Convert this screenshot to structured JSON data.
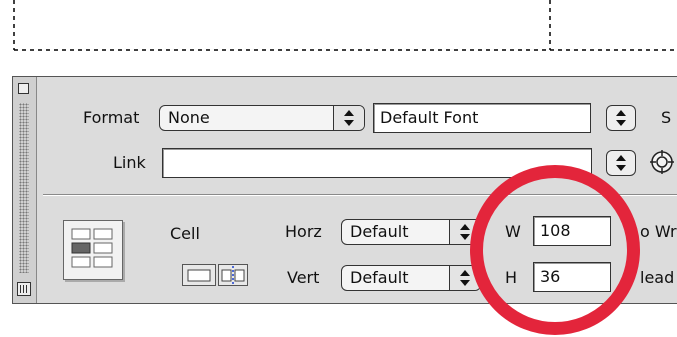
{
  "toolbar_top": {
    "format_label": "Format",
    "format_value": "None",
    "font_value": "Default Font",
    "size_label_partial": "S",
    "link_label": "Link",
    "link_value": ""
  },
  "cell_section": {
    "cell_label": "Cell",
    "horz_label": "Horz",
    "horz_value": "Default",
    "vert_label": "Vert",
    "vert_value": "Default",
    "w_label": "W",
    "w_value": "108",
    "h_label": "H",
    "h_value": "36",
    "nowrap_partial": "o Wr",
    "header_partial": "lead"
  },
  "colors": {
    "annotation_circle": "#e3253b",
    "panel_bg": "#dcdcdc"
  },
  "icons": [
    "close-box-icon",
    "expander-icon",
    "table-cell-icon",
    "merge-cells-icon",
    "split-cell-icon",
    "browse-target-icon",
    "popup-arrows-icon"
  ]
}
